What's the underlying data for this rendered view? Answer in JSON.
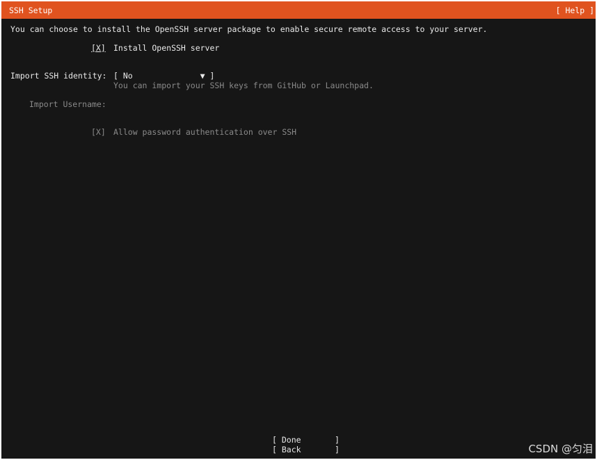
{
  "header": {
    "title": "SSH Setup",
    "help": "[ Help ]"
  },
  "intro": "You can choose to install the OpenSSH server package to enable secure remote access to your server.",
  "install_ssh": {
    "checkbox": "[X]",
    "label": "Install OpenSSH server",
    "checked": true
  },
  "import_identity": {
    "label": "Import SSH identity:",
    "value": "[ No              ▼ ]",
    "help": "You can import your SSH keys from GitHub or Launchpad."
  },
  "import_username": {
    "label": "Import Username:"
  },
  "allow_password": {
    "checkbox": "[X]",
    "label": "Allow password authentication over SSH",
    "checked": true
  },
  "buttons": {
    "done": "[ Done       ]",
    "back": "[ Back       ]"
  },
  "watermark": "CSDN @匀泪",
  "colors": {
    "titlebar": "#e0531f",
    "background": "#161616",
    "text": "#e9e9e9",
    "dim_text": "#8a8a8a"
  }
}
